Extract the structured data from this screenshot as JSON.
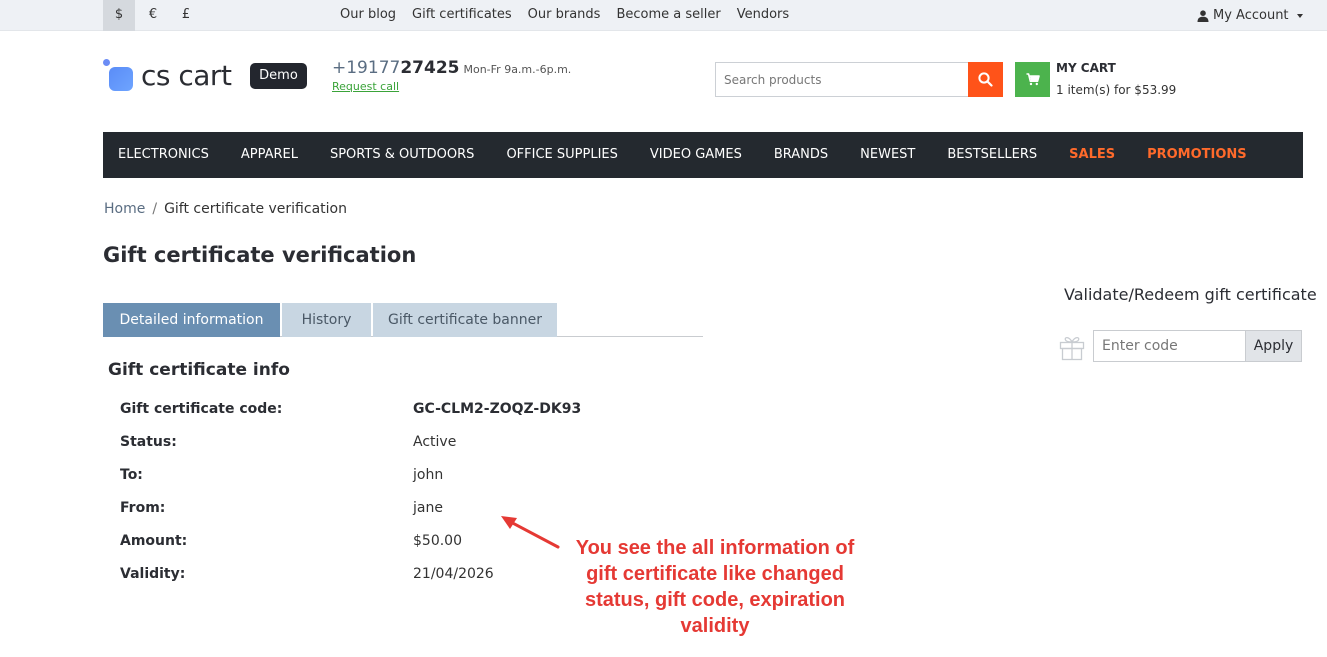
{
  "topbar": {
    "currencies": [
      "$",
      "€",
      "£"
    ],
    "links": [
      "Our blog",
      "Gift certificates",
      "Our brands",
      "Become a seller",
      "Vendors"
    ],
    "account_label": "My Account"
  },
  "header": {
    "logo_text": "cs cart",
    "demo_badge": "Demo",
    "phone_prefix": "+19177",
    "phone_main": "27425",
    "hours": "Mon-Fr 9a.m.-6p.m.",
    "request_call": "Request call",
    "search_placeholder": "Search products",
    "cart_title": "MY CART",
    "cart_summary": "1 item(s) for $53.99"
  },
  "nav": {
    "items": [
      "ELECTRONICS",
      "APPAREL",
      "SPORTS & OUTDOORS",
      "OFFICE SUPPLIES",
      "VIDEO GAMES",
      "BRANDS",
      "NEWEST",
      "BESTSELLERS",
      "SALES",
      "PROMOTIONS"
    ]
  },
  "breadcrumb": {
    "home": "Home",
    "separator": "/",
    "current": "Gift certificate verification"
  },
  "page_title": "Gift certificate verification",
  "tabs": [
    "Detailed information",
    "History",
    "Gift certificate banner"
  ],
  "info": {
    "section_title": "Gift certificate info",
    "rows": [
      {
        "label": "Gift certificate code:",
        "value": "GC-CLM2-ZOQZ-DK93"
      },
      {
        "label": "Status:",
        "value": "Active"
      },
      {
        "label": "To:",
        "value": "john"
      },
      {
        "label": "From:",
        "value": "jane"
      },
      {
        "label": "Amount:",
        "value": "$50.00"
      },
      {
        "label": "Validity:",
        "value": "21/04/2026"
      }
    ]
  },
  "annotation": {
    "lines": [
      "You see the all information of",
      "gift certificate like changed",
      "status, gift code, expiration",
      "validity"
    ],
    "color": "#e53934"
  },
  "sidebar": {
    "title": "Validate/Redeem gift certificate",
    "code_placeholder": "Enter code",
    "apply_label": "Apply"
  },
  "colors": {
    "nav_bg": "#24292f",
    "accent_orange": "#ff5319",
    "cart_green": "#4cb34d",
    "tab_active": "#6a8fb2",
    "tab_inactive": "#c8d6e2",
    "promo_text": "#ff6a2b"
  }
}
